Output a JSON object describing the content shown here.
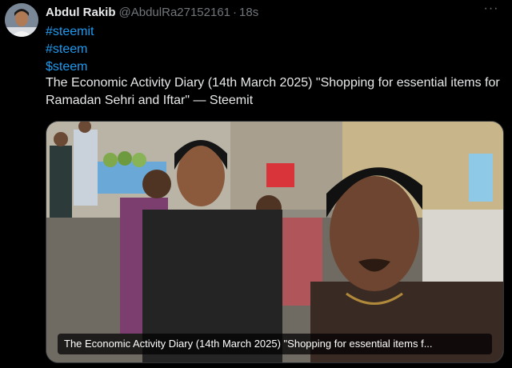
{
  "author": {
    "name": "Abdul Rakib",
    "handle": "@AbdulRa27152161",
    "separator": "·",
    "time": "18s"
  },
  "more_label": "···",
  "hashtags": [
    "#steemit",
    "#steem",
    "$steem"
  ],
  "body": "The Economic Activity Diary (14th March 2025) \"Shopping for essential items for Ramadan Sehri and Iftar\" — Steemit",
  "media": {
    "caption": "The Economic Activity Diary (14th March 2025) \"Shopping for essential items f..."
  },
  "icons": {
    "avatar": "avatar-photo",
    "more": "more-options-icon"
  },
  "colors": {
    "background": "#000000",
    "text": "#e7e9ea",
    "muted": "#71767b",
    "link": "#1d9bf0"
  }
}
